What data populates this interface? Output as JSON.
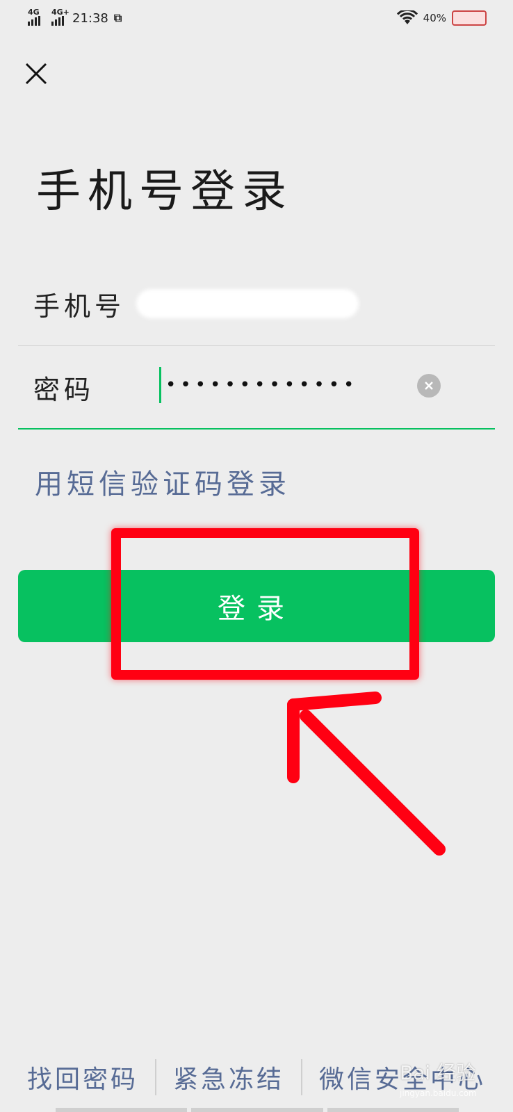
{
  "status_bar": {
    "network_1": "4G",
    "network_2": "4G+",
    "time": "21:38",
    "battery": "40%"
  },
  "page": {
    "title": "手机号登录"
  },
  "form": {
    "phone_label": "手机号",
    "password_label": "密码",
    "password_mask": "•••••••••••••"
  },
  "sms_login_link": "用短信验证码登录",
  "login_button": "登录",
  "footer": {
    "links": [
      "找回密码",
      "紧急冻结",
      "微信安全中心"
    ]
  },
  "watermark": {
    "text": "Bai 经验",
    "sub": "jingyan.baidu.com"
  },
  "colors": {
    "accent_green": "#07c160",
    "link_blue": "#576b95",
    "annotation_red": "#ff0012",
    "background": "#ededed"
  }
}
